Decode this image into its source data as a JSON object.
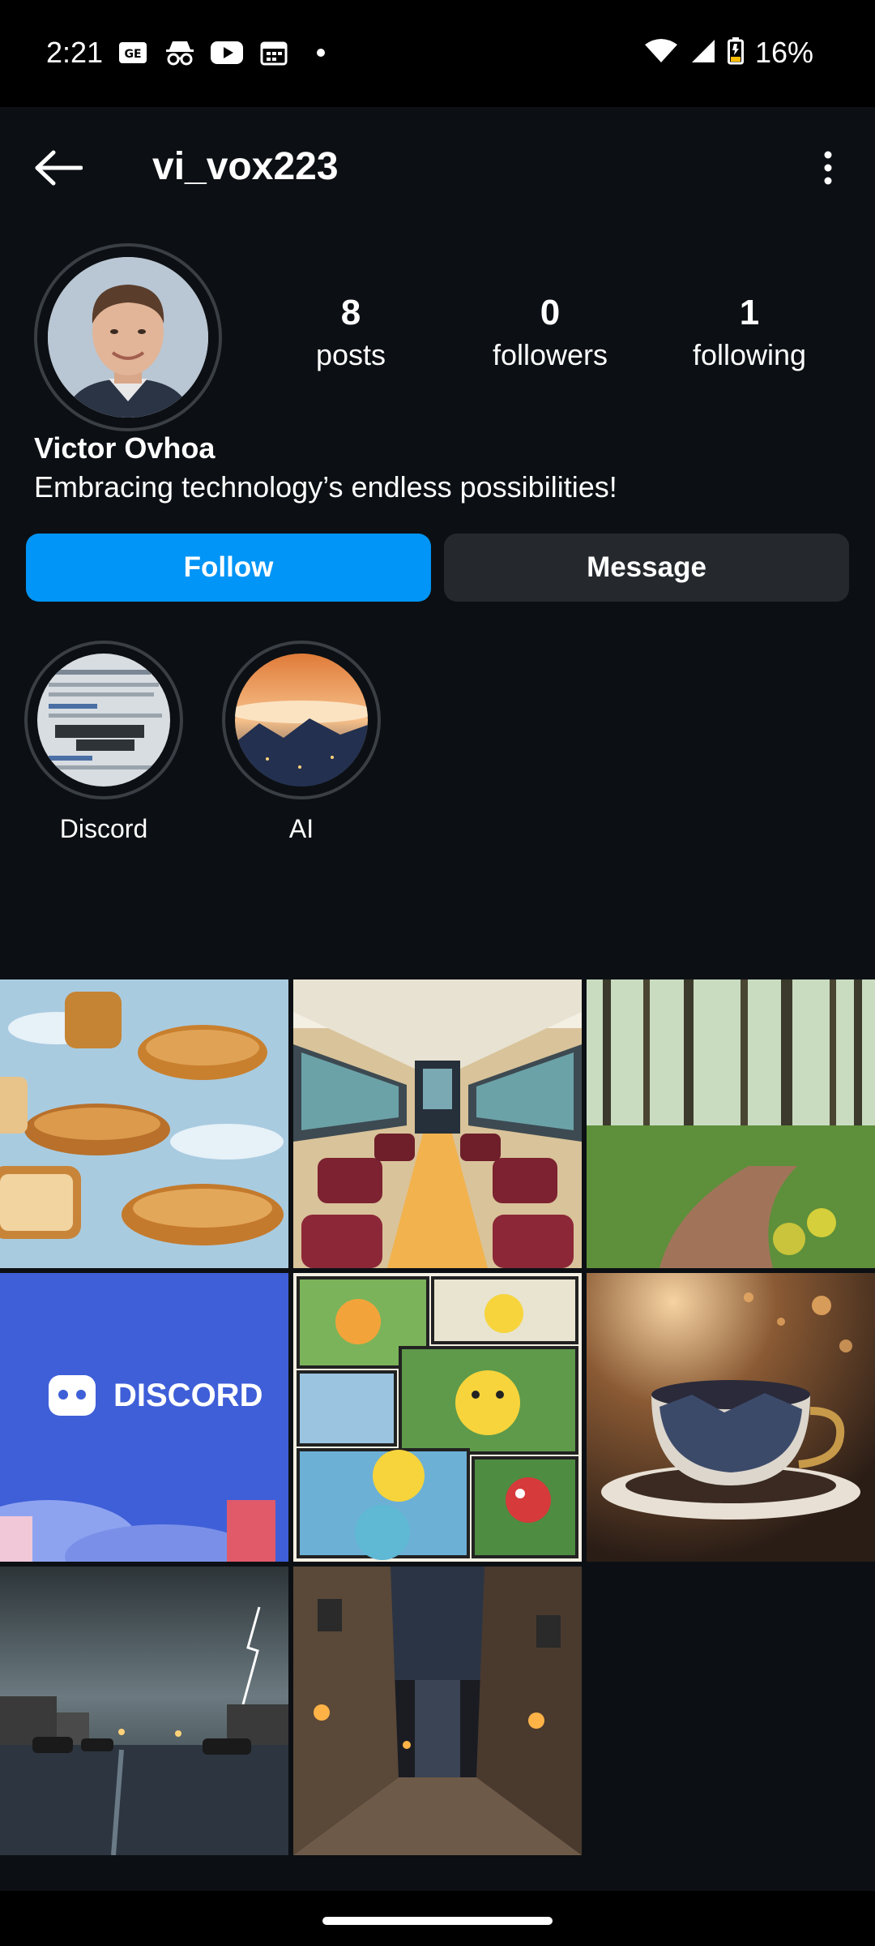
{
  "status_bar": {
    "time": "2:21",
    "battery": "16%"
  },
  "header": {
    "username": "vi_vox223"
  },
  "profile": {
    "full_name": "Victor Ovhoa",
    "bio": "Embracing technology’s endless possibilities!",
    "stats": [
      {
        "value": "8",
        "label": "posts"
      },
      {
        "value": "0",
        "label": "followers"
      },
      {
        "value": "1",
        "label": "following"
      }
    ]
  },
  "actions": {
    "follow_label": "Follow",
    "message_label": "Message"
  },
  "highlights": [
    {
      "label": "Discord"
    },
    {
      "label": "AI"
    }
  ],
  "posts": [
    {
      "description": "bread"
    },
    {
      "description": "train interior"
    },
    {
      "description": "forest path"
    },
    {
      "description": "discord",
      "text": "DISCORD"
    },
    {
      "description": "pokemon comic"
    },
    {
      "description": "teacup"
    },
    {
      "description": "storm street"
    },
    {
      "description": "medieval alley"
    }
  ],
  "colors": {
    "accent": "#0095f6",
    "background": "#0c1014",
    "button_dark": "#25292e"
  }
}
